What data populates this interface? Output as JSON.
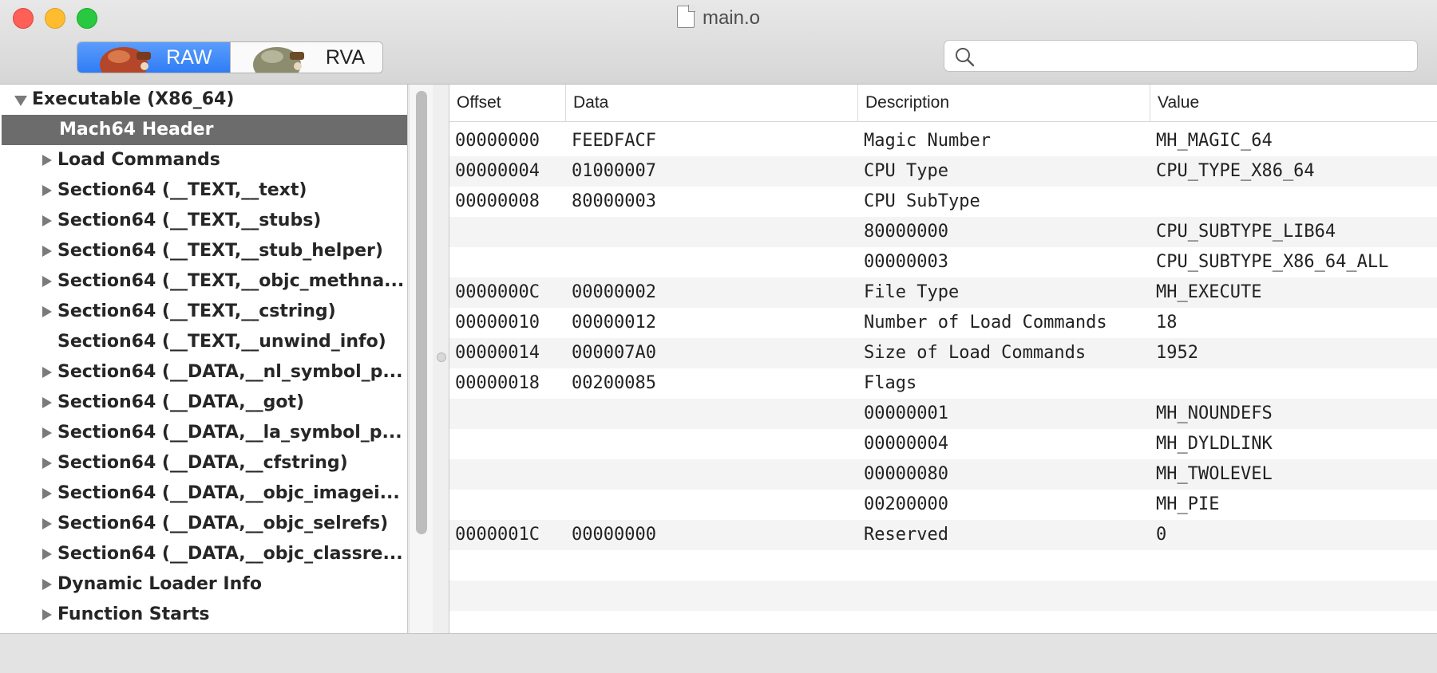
{
  "window": {
    "title": "main.o"
  },
  "toolbar": {
    "segments": [
      {
        "label": "RAW",
        "icon": "raw-mode-icon",
        "selected": true
      },
      {
        "label": "RVA",
        "icon": "rva-mode-icon",
        "selected": false
      }
    ],
    "search": {
      "placeholder": "",
      "value": ""
    }
  },
  "sidebar": {
    "items": [
      {
        "label": "Executable (X86_64)",
        "expander": "expanded",
        "level": 0
      },
      {
        "label": "Mach64 Header",
        "expander": "none",
        "level": 1,
        "selected": true
      },
      {
        "label": "Load Commands",
        "expander": "collapsed",
        "level": 1
      },
      {
        "label": "Section64 (__TEXT,__text)",
        "expander": "collapsed",
        "level": 1
      },
      {
        "label": "Section64 (__TEXT,__stubs)",
        "expander": "collapsed",
        "level": 1
      },
      {
        "label": "Section64 (__TEXT,__stub_helper)",
        "expander": "collapsed",
        "level": 1
      },
      {
        "label": "Section64 (__TEXT,__objc_methna...",
        "expander": "collapsed",
        "level": 1
      },
      {
        "label": "Section64 (__TEXT,__cstring)",
        "expander": "collapsed",
        "level": 1
      },
      {
        "label": "Section64 (__TEXT,__unwind_info)",
        "expander": "none",
        "level": 1
      },
      {
        "label": "Section64 (__DATA,__nl_symbol_p...",
        "expander": "collapsed",
        "level": 1
      },
      {
        "label": "Section64 (__DATA,__got)",
        "expander": "collapsed",
        "level": 1
      },
      {
        "label": "Section64 (__DATA,__la_symbol_p...",
        "expander": "collapsed",
        "level": 1
      },
      {
        "label": "Section64 (__DATA,__cfstring)",
        "expander": "collapsed",
        "level": 1
      },
      {
        "label": "Section64 (__DATA,__objc_imagei...",
        "expander": "collapsed",
        "level": 1
      },
      {
        "label": "Section64 (__DATA,__objc_selrefs)",
        "expander": "collapsed",
        "level": 1
      },
      {
        "label": "Section64 (__DATA,__objc_classre...",
        "expander": "collapsed",
        "level": 1
      },
      {
        "label": "Dynamic Loader Info",
        "expander": "collapsed",
        "level": 1
      },
      {
        "label": "Function Starts",
        "expander": "collapsed",
        "level": 1
      }
    ]
  },
  "table": {
    "columns": [
      "Offset",
      "Data",
      "Description",
      "Value"
    ],
    "rows": [
      [
        "00000000",
        "FEEDFACF",
        "Magic Number",
        "MH_MAGIC_64"
      ],
      [
        "00000004",
        "01000007",
        "CPU Type",
        "CPU_TYPE_X86_64"
      ],
      [
        "00000008",
        "80000003",
        "CPU SubType",
        ""
      ],
      [
        "",
        "",
        "80000000",
        "CPU_SUBTYPE_LIB64"
      ],
      [
        "",
        "",
        "00000003",
        "CPU_SUBTYPE_X86_64_ALL"
      ],
      [
        "0000000C",
        "00000002",
        "File Type",
        "MH_EXECUTE"
      ],
      [
        "00000010",
        "00000012",
        "Number of Load Commands",
        "18"
      ],
      [
        "00000014",
        "000007A0",
        "Size of Load Commands",
        "1952"
      ],
      [
        "00000018",
        "00200085",
        "Flags",
        ""
      ],
      [
        "",
        "",
        "00000001",
        "MH_NOUNDEFS"
      ],
      [
        "",
        "",
        "00000004",
        "MH_DYLDLINK"
      ],
      [
        "",
        "",
        "00000080",
        "MH_TWOLEVEL"
      ],
      [
        "",
        "",
        "00200000",
        "MH_PIE"
      ],
      [
        "0000001C",
        "00000000",
        "Reserved",
        "0"
      ]
    ]
  }
}
